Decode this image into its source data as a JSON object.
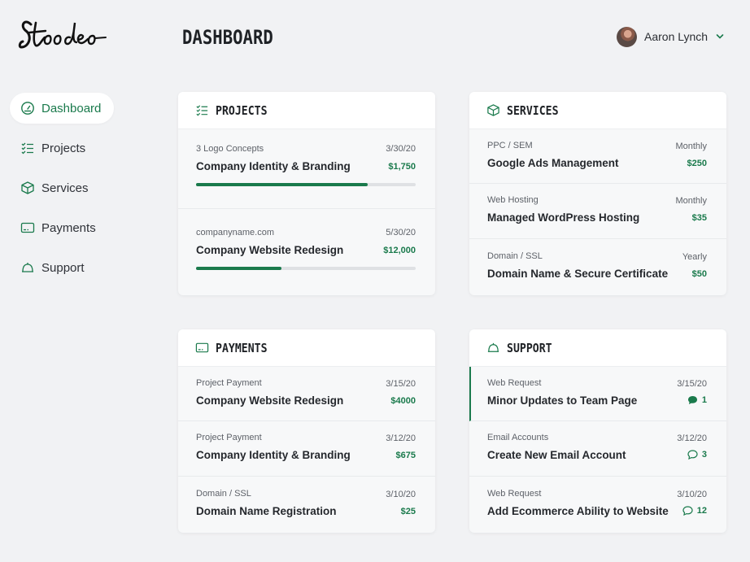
{
  "brand": {
    "logo_text": "Stoodeo"
  },
  "header": {
    "title": "DASHBOARD",
    "user_name": "Aaron Lynch"
  },
  "colors": {
    "accent": "#1a7a4c",
    "background": "#f1f2f4",
    "card": "#f7f8f9"
  },
  "sidebar": {
    "items": [
      {
        "label": "Dashboard",
        "icon": "gauge-icon",
        "active": true
      },
      {
        "label": "Projects",
        "icon": "checklist-icon",
        "active": false
      },
      {
        "label": "Services",
        "icon": "box-icon",
        "active": false
      },
      {
        "label": "Payments",
        "icon": "credit-card-icon",
        "active": false
      },
      {
        "label": "Support",
        "icon": "bell-icon",
        "active": false
      }
    ]
  },
  "projects": {
    "title": "PROJECTS",
    "rows": [
      {
        "subtitle": "3 Logo Concepts",
        "name": "Company Identity & Branding",
        "date": "3/30/20",
        "amount": "$1,750",
        "progress": 0.78
      },
      {
        "subtitle": "companyname.com",
        "name": "Company Website Redesign",
        "date": "5/30/20",
        "amount": "$12,000",
        "progress": 0.39
      }
    ]
  },
  "services": {
    "title": "SERVICES",
    "rows": [
      {
        "subtitle": "PPC / SEM",
        "name": "Google Ads Management",
        "period": "Monthly",
        "amount": "$250"
      },
      {
        "subtitle": "Web Hosting",
        "name": "Managed WordPress Hosting",
        "period": "Monthly",
        "amount": "$35"
      },
      {
        "subtitle": "Domain / SSL",
        "name": "Domain Name & Secure Certificate",
        "period": "Yearly",
        "amount": "$50"
      }
    ]
  },
  "payments": {
    "title": "PAYMENTS",
    "rows": [
      {
        "subtitle": "Project Payment",
        "name": "Company Website Redesign",
        "date": "3/15/20",
        "amount": "$4000"
      },
      {
        "subtitle": "Project Payment",
        "name": "Company Identity & Branding",
        "date": "3/12/20",
        "amount": "$675"
      },
      {
        "subtitle": "Domain / SSL",
        "name": "Domain Name Registration",
        "date": "3/10/20",
        "amount": "$25"
      }
    ]
  },
  "support": {
    "title": "SUPPORT",
    "rows": [
      {
        "subtitle": "Web Request",
        "name": "Minor Updates to Team Page",
        "date": "3/15/20",
        "comments": "1",
        "unread": true
      },
      {
        "subtitle": "Email Accounts",
        "name": "Create New Email Account",
        "date": "3/12/20",
        "comments": "3",
        "unread": false
      },
      {
        "subtitle": "Web Request",
        "name": "Add Ecommerce Ability to Website",
        "date": "3/10/20",
        "comments": "12",
        "unread": false
      }
    ]
  }
}
